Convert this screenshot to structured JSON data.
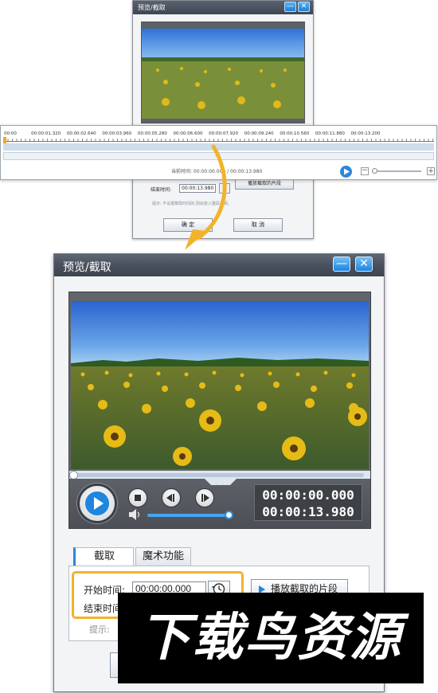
{
  "small_dialog": {
    "title": "预览/截取",
    "minimize_glyph": "—",
    "close_glyph": "✕",
    "current_time_label": "当前时间: 00:00:00.000 / 00:00:13.980",
    "end_time_label": "结束时间:",
    "end_time_value": "00:00:13.980",
    "play_segment_label": "播放截取的片段",
    "hint": "提示: 不设置截取时间的,则会放入整段视频。",
    "ok_label": "确 定",
    "cancel_label": "取 消"
  },
  "timeline": {
    "ticks": [
      "00:00",
      "00:00:01.320",
      "00:00:02.640",
      "00:00:03.960",
      "00:00:05.280",
      "00:00:06.600",
      "00:00:07.920",
      "00:00:09.240",
      "00:00:10.560",
      "00:00:11.880",
      "00:00:13.200"
    ],
    "scroll_grip": ":::",
    "current_time": "当前时间: 00:00:00.000 / 00:00:13.980",
    "zoom_minus": "−",
    "zoom_plus": "+"
  },
  "big_dialog": {
    "title": "预览/截取",
    "minimize_glyph": "—",
    "close_glyph": "✕",
    "current_time": "00:00:00.000",
    "total_time": "00:00:13.980",
    "volume_level": 0.95,
    "tabs": [
      {
        "label": "截取",
        "active": true
      },
      {
        "label": "魔术功能",
        "active": false
      }
    ],
    "start_time_label": "开始时间:",
    "start_time_value": "00:00:00.000",
    "end_time_label": "结束时间",
    "play_segment_label": "播放截取的片段",
    "hint_prefix": "提示:",
    "accent_color": "#f2b32a",
    "title_bar_color": "#4a515d",
    "button_color": "#1f85de"
  },
  "watermark": {
    "text": "下载鸟资源"
  }
}
